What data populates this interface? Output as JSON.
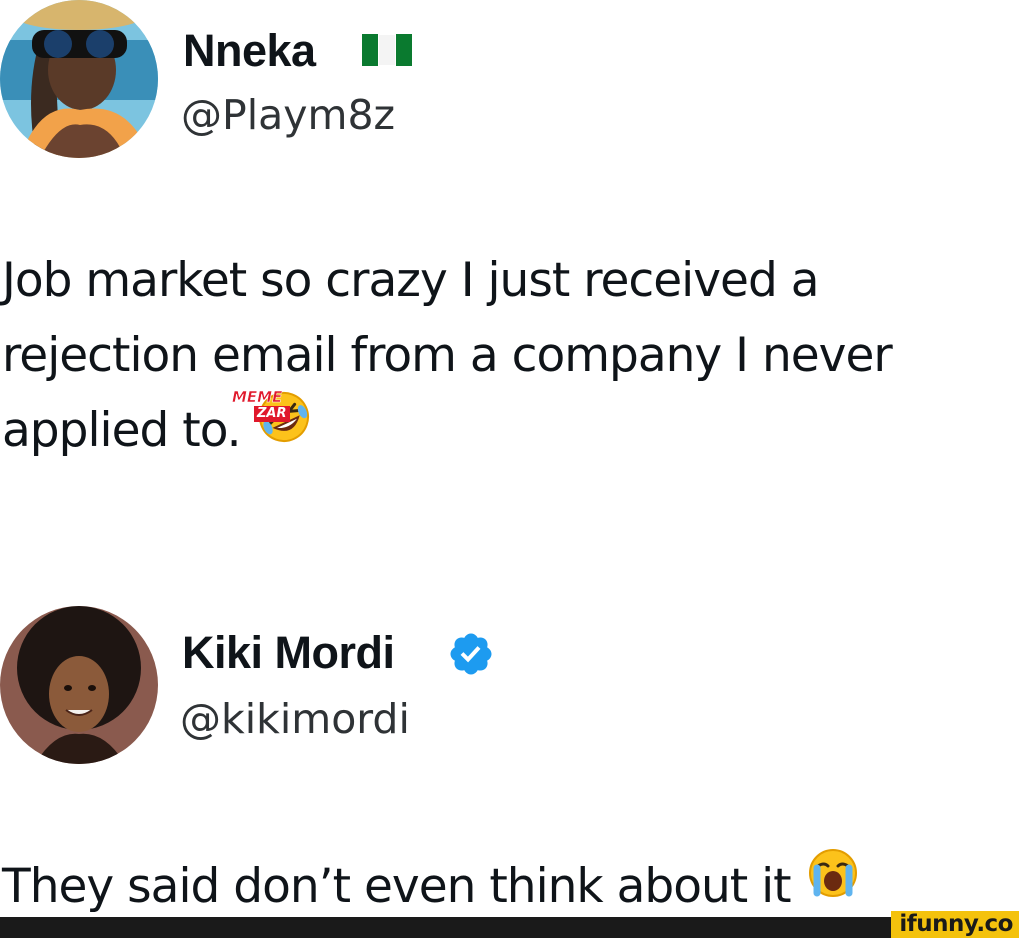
{
  "posts": [
    {
      "name": "Nneka",
      "handle": "@Playm8z",
      "text_lines": [
        "Job market so crazy I just received a",
        "rejection email from a company I never",
        "applied to."
      ],
      "badge": "nigeria-flag",
      "emoji": "rolling-on-floor-laughing"
    },
    {
      "name": "Kiki Mordi",
      "handle": "@kikimordi",
      "text_lines": [
        "They said don’t even think about it"
      ],
      "badge": "verified",
      "emoji": "loudly-crying"
    }
  ],
  "watermark": {
    "top": "MEME",
    "box": "ZAR"
  },
  "brand": {
    "label": "ifunny.co",
    "color": "#f4c20d"
  },
  "colors": {
    "verified": "#1d9bf0",
    "text": "#0f1419"
  }
}
